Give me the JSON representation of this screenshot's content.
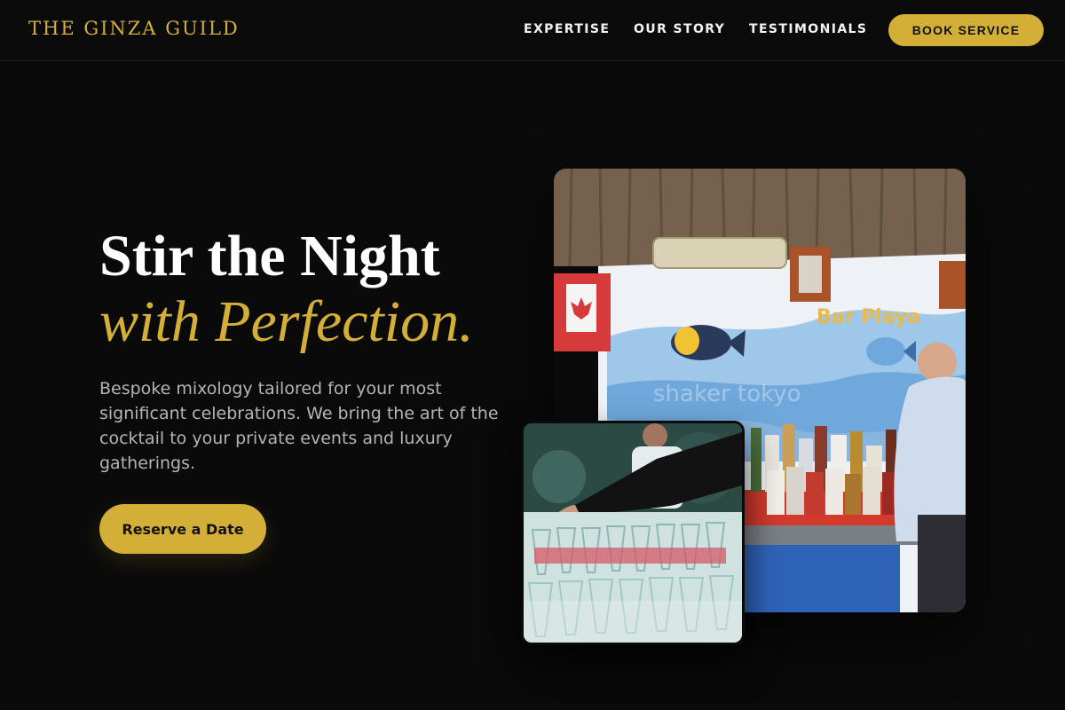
{
  "header": {
    "logo": "THE GINZA GUILD",
    "nav": [
      "EXPERTISE",
      "OUR STORY",
      "TESTIMONIALS"
    ],
    "cta": "BOOK SERVICE"
  },
  "hero": {
    "title_line1": "Stir the Night",
    "title_line2": "with Perfection.",
    "description": "Bespoke mixology tailored for your most significant celebrations. We bring the art of the cocktail to your private events and luxury gatherings.",
    "cta": "Reserve a Date"
  },
  "images": {
    "main_sign": "Bar Playa",
    "main_watermark": "shaker tokyo"
  },
  "colors": {
    "accent": "#d4af37",
    "background": "#0a0a0a",
    "text_muted": "#b4b4b4"
  }
}
